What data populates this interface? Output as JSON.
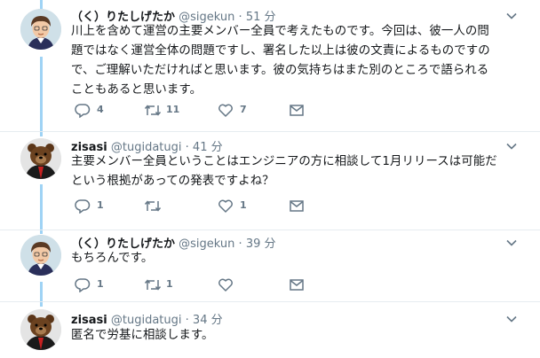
{
  "tweets": [
    {
      "name": "（く）りたしげたか",
      "handle": "@sigekun",
      "dot": "·",
      "time": "51 分",
      "lines": [
        "川上を含めて運営の主要メンバー全員で考えたものです。今回は、彼一人の問",
        "題ではなく運営全体の問題ですし、署名した以上は彼の文責によるものですの",
        "で、ご理解いただければと思います。彼の気持ちはまた別のところで語られる",
        "こともあると思います。"
      ],
      "reply_count": "4",
      "retweet_count": "11",
      "like_count": "7"
    },
    {
      "name": "zisasi",
      "handle": "@tugidatugi",
      "dot": "·",
      "time": "41 分",
      "lines": [
        "主要メンバー全員ということはエンジニアの方に相談して1月リリースは可能だ",
        "という根拠があっての発表ですよね？"
      ],
      "reply_count": "1",
      "retweet_count": "",
      "like_count": "1"
    },
    {
      "name": "（く）りたしげたか",
      "handle": "@sigekun",
      "dot": "·",
      "time": "39 分",
      "lines": [
        "もちろんです。"
      ],
      "reply_count": "1",
      "retweet_count": "1",
      "like_count": ""
    },
    {
      "name": "zisasi",
      "handle": "@tugidatugi",
      "dot": "·",
      "time": "34 分",
      "lines": [
        "匿名で労基に相談します。"
      ],
      "reply_count": "",
      "retweet_count": "",
      "like_count": ""
    }
  ],
  "colors": {
    "thread_line": "#9fd3f5",
    "icon": "#657786",
    "text": "#14171a",
    "divider": "#e6ecf0"
  },
  "icons": [
    "reply-icon",
    "retweet-icon",
    "like-icon",
    "message-icon",
    "chevron-down-icon"
  ]
}
